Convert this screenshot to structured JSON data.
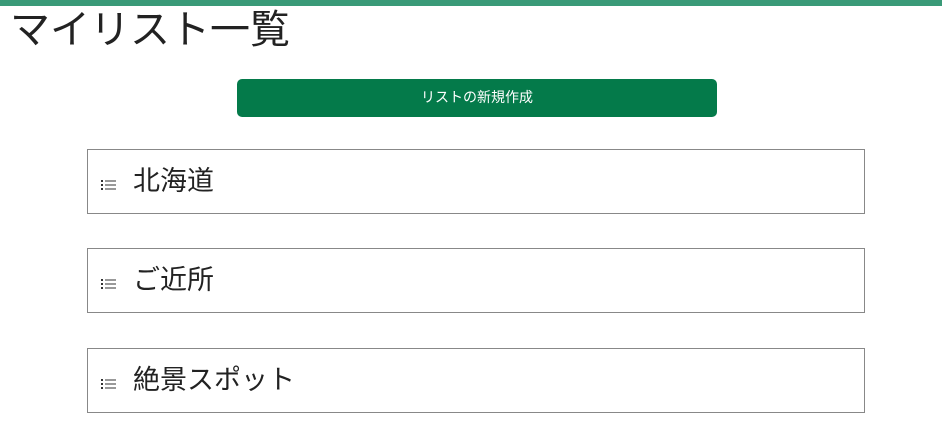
{
  "header": {
    "title": "マイリスト一覧",
    "accent_color": "#3a9a78"
  },
  "actions": {
    "create_label": "リストの新規作成",
    "create_color": "#047a4a"
  },
  "lists": {
    "icon": "list-icon",
    "items": [
      {
        "label": "北海道"
      },
      {
        "label": "ご近所"
      },
      {
        "label": "絶景スポット"
      }
    ]
  }
}
